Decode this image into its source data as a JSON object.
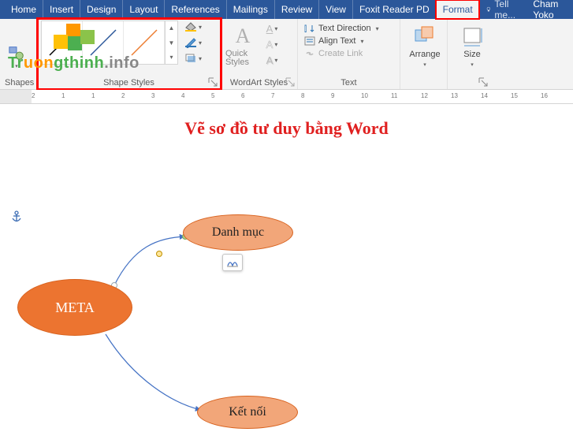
{
  "tabs": [
    "Home",
    "Insert",
    "Design",
    "Layout",
    "References",
    "Mailings",
    "Review",
    "View",
    "Foxit Reader PD",
    "Format"
  ],
  "active_tab_index": 9,
  "highlighted_tab_index": 9,
  "tell_me": "Tell me...",
  "user_name": "Cham Yoko",
  "ribbon": {
    "insert_shapes": {
      "label": "Shapes"
    },
    "shape_styles": {
      "label": "Shape Styles"
    },
    "wordart_styles": {
      "label": "WordArt Styles",
      "quick_styles_label": "Quick Styles"
    },
    "text": {
      "label": "Text",
      "direction": "Text Direction",
      "align": "Align Text",
      "link": "Create Link"
    },
    "arrange": {
      "label": "Arrange"
    },
    "size": {
      "label": "Size"
    }
  },
  "ruler_numbers": [
    "2",
    "1",
    "1",
    "2",
    "3",
    "4",
    "5",
    "6",
    "7",
    "8",
    "9",
    "10",
    "11",
    "12",
    "13",
    "14",
    "15",
    "16"
  ],
  "document": {
    "title": "Vẽ sơ đồ tư duy bằng Word",
    "shapes": {
      "meta": "META",
      "danhmuc": "Danh mục",
      "ketnoi": "Kết nối"
    }
  },
  "watermark": {
    "text": "Truongthinh",
    "suffix": ".info"
  }
}
